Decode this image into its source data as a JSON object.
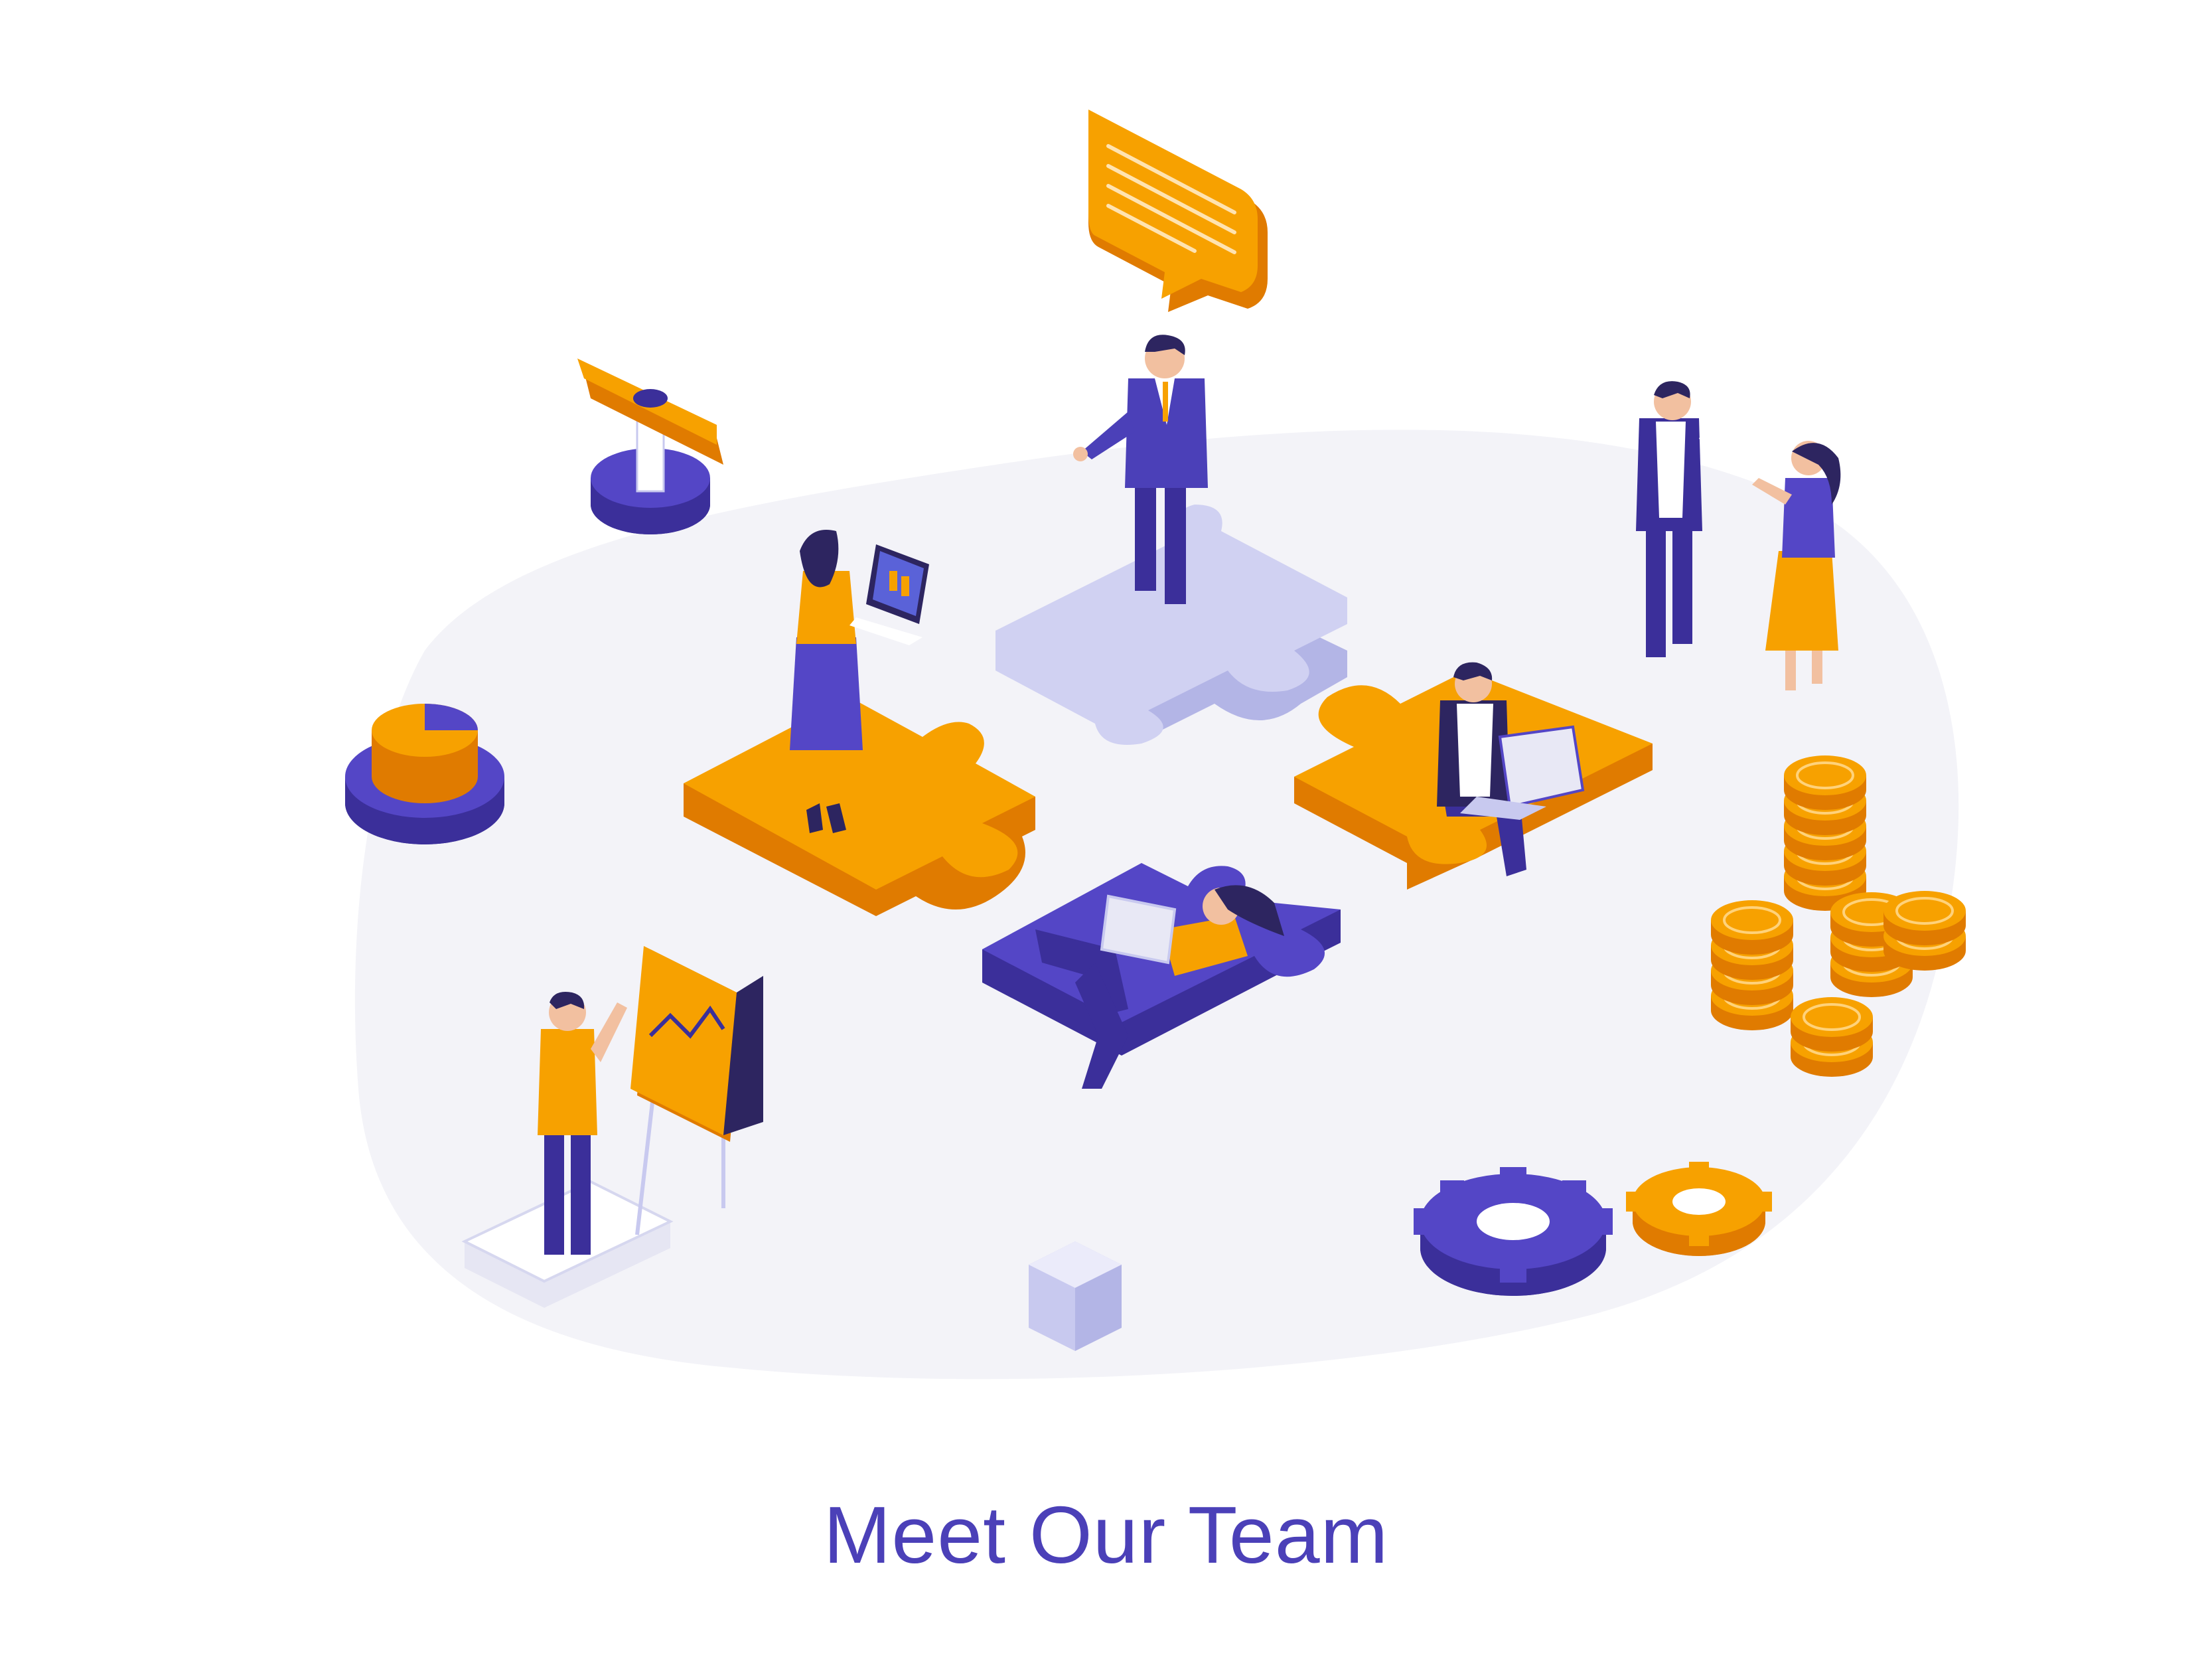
{
  "title": "Meet Our Team",
  "palette": {
    "accent_orange": "#f7a100",
    "accent_orange_dark": "#e07b00",
    "accent_purple": "#5446c6",
    "accent_purple_dark": "#3b2f9a",
    "lavender": "#c8c9ef",
    "backdrop": "#f3f3f8",
    "skin": "#f2c0a0"
  },
  "icons": [
    "speech-bubble-icon",
    "puzzle-piece-icon",
    "gear-icon",
    "coin-stack-icon",
    "pie-chart-icon",
    "flipchart-icon",
    "laptop-icon",
    "cube-icon",
    "signpost-icon"
  ]
}
